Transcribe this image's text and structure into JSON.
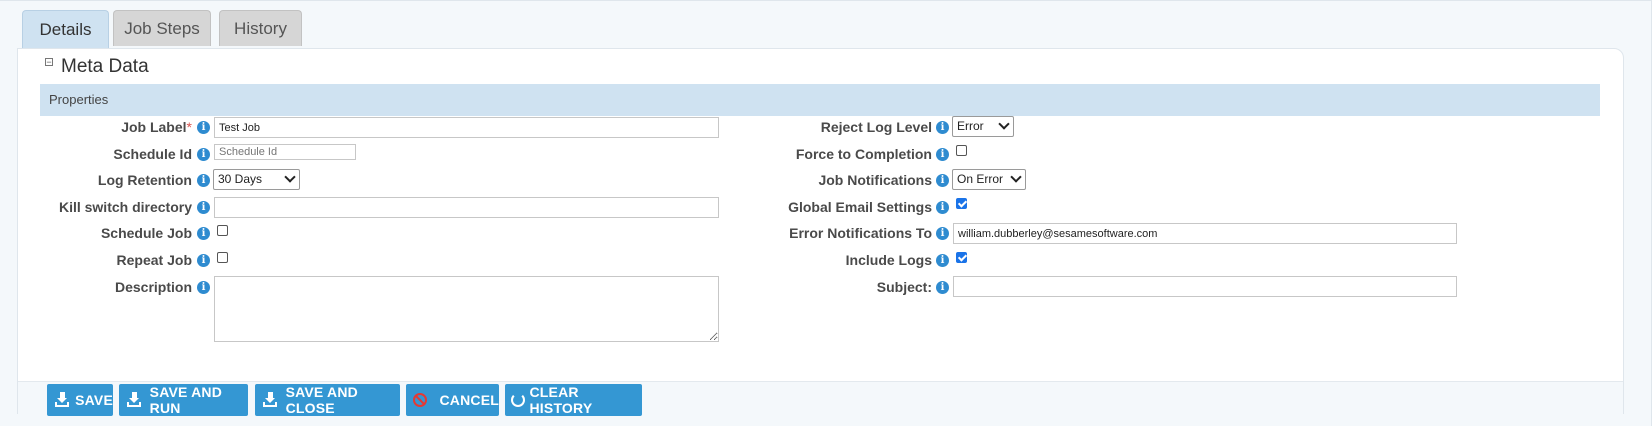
{
  "tabs": [
    {
      "label": "Details",
      "active": true
    },
    {
      "label": "Job Steps",
      "active": false
    },
    {
      "label": "History",
      "active": false
    }
  ],
  "meta_section": {
    "toggle_symbol": "−",
    "title": "Meta Data"
  },
  "properties_header": "Properties",
  "info_symbol": "i",
  "required_marker": "*",
  "left_fields": {
    "job_label": {
      "label": "Job Label",
      "value": "Test Job"
    },
    "schedule_id": {
      "label": "Schedule Id",
      "placeholder": "Schedule Id"
    },
    "log_retention": {
      "label": "Log Retention",
      "value": "30 Days"
    },
    "kill_switch": {
      "label": "Kill switch directory",
      "value": ""
    },
    "schedule_job": {
      "label": "Schedule Job",
      "checked": false
    },
    "repeat_job": {
      "label": "Repeat Job",
      "checked": false
    },
    "description": {
      "label": "Description",
      "value": ""
    }
  },
  "right_fields": {
    "reject_log_level": {
      "label": "Reject Log Level",
      "value": "Error"
    },
    "force_completion": {
      "label": "Force to Completion",
      "checked": false
    },
    "job_notifications": {
      "label": "Job Notifications",
      "value": "On Error"
    },
    "global_email": {
      "label": "Global Email Settings",
      "checked": true
    },
    "error_notifications": {
      "label": "Error Notifications To",
      "value": "william.dubberley@sesamesoftware.com"
    },
    "include_logs": {
      "label": "Include Logs",
      "checked": true
    },
    "subject": {
      "label": "Subject:",
      "value": ""
    }
  },
  "buttons": {
    "save": "SAVE",
    "save_and_run": "SAVE AND RUN",
    "save_and_close": "SAVE AND CLOSE",
    "cancel": "CANCEL",
    "clear_history": "CLEAR HISTORY"
  },
  "colors": {
    "accent": "#3497d3",
    "header_bar": "#cfe2f1",
    "info_icon": "#2e8bd0",
    "required": "#d9534f",
    "cancel_icon": "#e53935"
  }
}
